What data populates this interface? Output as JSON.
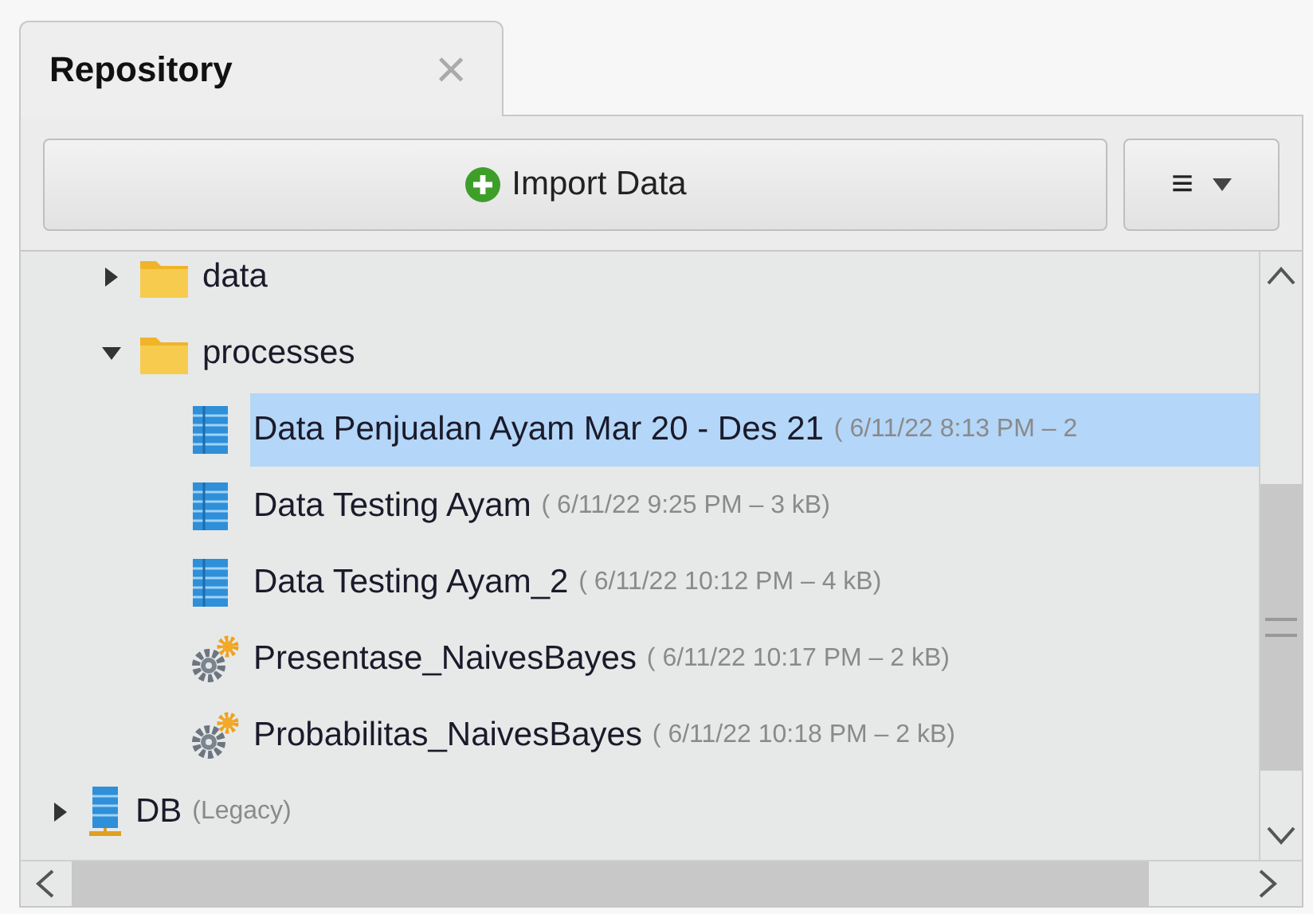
{
  "tab": {
    "title": "Repository",
    "close": "×",
    "selected": true
  },
  "toolbar": {
    "import_button": "Import Data",
    "menu_button": "≡"
  },
  "tree": {
    "items": [
      {
        "label": "data",
        "kind": "folder",
        "expanded": false,
        "selected": false
      },
      {
        "label": "processes",
        "kind": "folder",
        "expanded": true,
        "selected": false,
        "children": [
          {
            "label": "Data Penjualan Ayam Mar 20 - Des 21",
            "details": "( 6/11/22 8:13 PM – 2",
            "kind": "dataset",
            "selected": true
          },
          {
            "label": "Data Testing Ayam",
            "details": "( 6/11/22 9:25 PM – 3 kB)",
            "kind": "dataset",
            "selected": false
          },
          {
            "label": "Data Testing Ayam_2",
            "details": "( 6/11/22 10:12 PM – 4 kB)",
            "kind": "dataset",
            "selected": false
          },
          {
            "label": "Presentase_NaivesBayes",
            "details": "( 6/11/22 10:17 PM – 2 kB)",
            "kind": "process",
            "selected": false
          },
          {
            "label": "Probabilitas_NaivesBayes",
            "details": "( 6/11/22 10:18 PM – 2 kB)",
            "kind": "process",
            "selected": false
          }
        ]
      }
    ],
    "roots": [
      {
        "label": "DB",
        "details": "(Legacy)",
        "kind": "repository",
        "expanded": false,
        "selected": false
      }
    ]
  }
}
